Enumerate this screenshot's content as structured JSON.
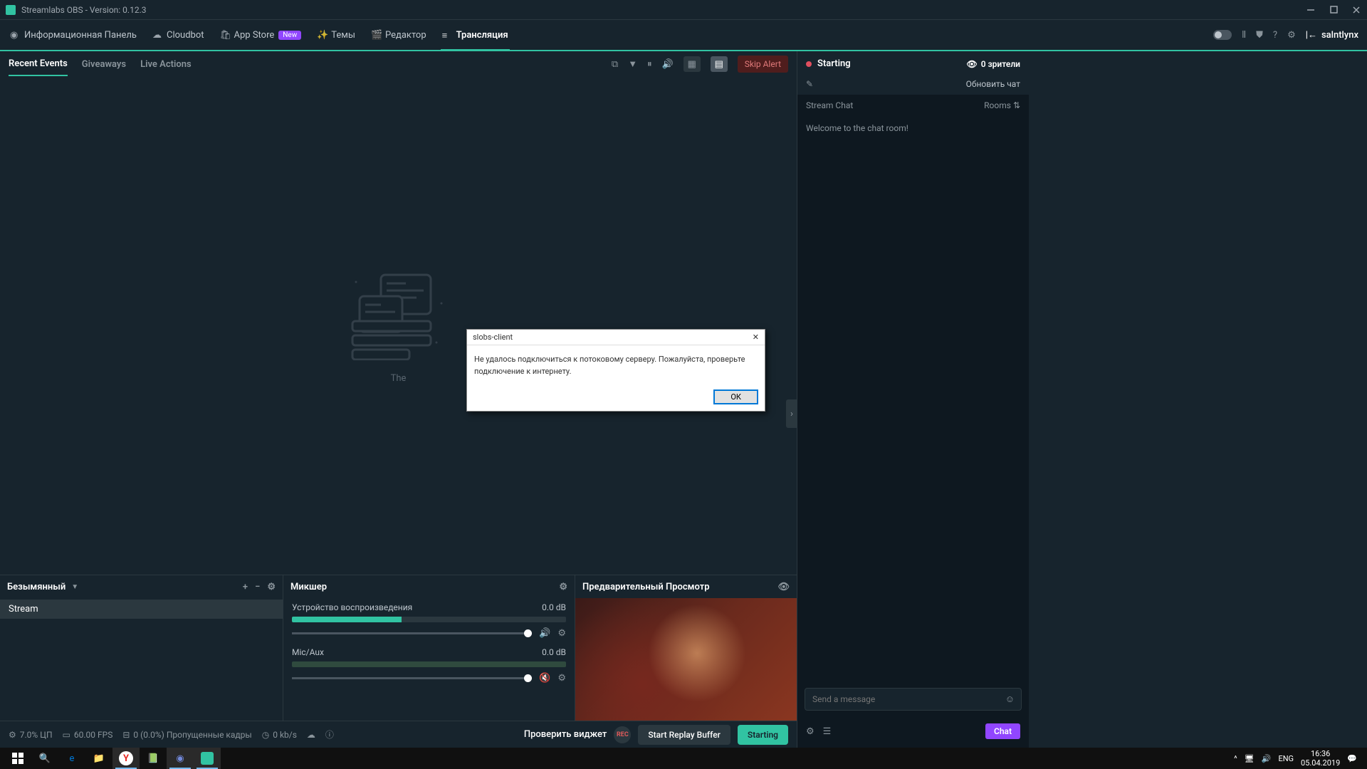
{
  "titlebar": {
    "title": "Streamlabs OBS - Version: 0.12.3"
  },
  "nav": {
    "dashboard": "Информационная Панель",
    "cloudbot": "Cloudbot",
    "appstore": "App Store",
    "appstore_badge": "New",
    "themes": "Темы",
    "editor": "Редактор",
    "live": "Трансляция"
  },
  "user": {
    "name": "salntlynx"
  },
  "events": {
    "tab_recent": "Recent Events",
    "tab_giveaways": "Giveaways",
    "tab_liveactions": "Live Actions",
    "skip": "Skip Alert",
    "empty_text": "The"
  },
  "scenes": {
    "title": "Безымянный",
    "item1": "Stream"
  },
  "mixer": {
    "title": "Микшер",
    "dev1": "Устройство воспроизведения",
    "dev1_db": "0.0 dB",
    "dev2": "Mic/Aux",
    "dev2_db": "0.0 dB"
  },
  "preview": {
    "title": "Предварительный Просмотр"
  },
  "footer": {
    "cpu": "7.0% ЦП",
    "fps": "60.00 FPS",
    "dropped": "0 (0.0%) Пропущенные кадры",
    "bitrate": "0 kb/s",
    "test_widget": "Проверить виджет",
    "replay": "Start Replay Buffer",
    "starting": "Starting"
  },
  "rightpanel": {
    "status": "Starting",
    "viewers": "0 зрители",
    "refresh": "Обновить чат",
    "chat_header": "Stream Chat",
    "rooms": "Rooms",
    "welcome": "Welcome to the chat room!",
    "placeholder": "Send a message",
    "chat_btn": "Chat"
  },
  "dialog": {
    "title": "slobs-client",
    "body": "Не удалось подключиться к потоковому серверу. Пожалуйста, проверьте подключение к интернету.",
    "ok": "ОК"
  },
  "taskbar": {
    "lang": "ENG",
    "time": "16:36",
    "date": "05.04.2019"
  }
}
